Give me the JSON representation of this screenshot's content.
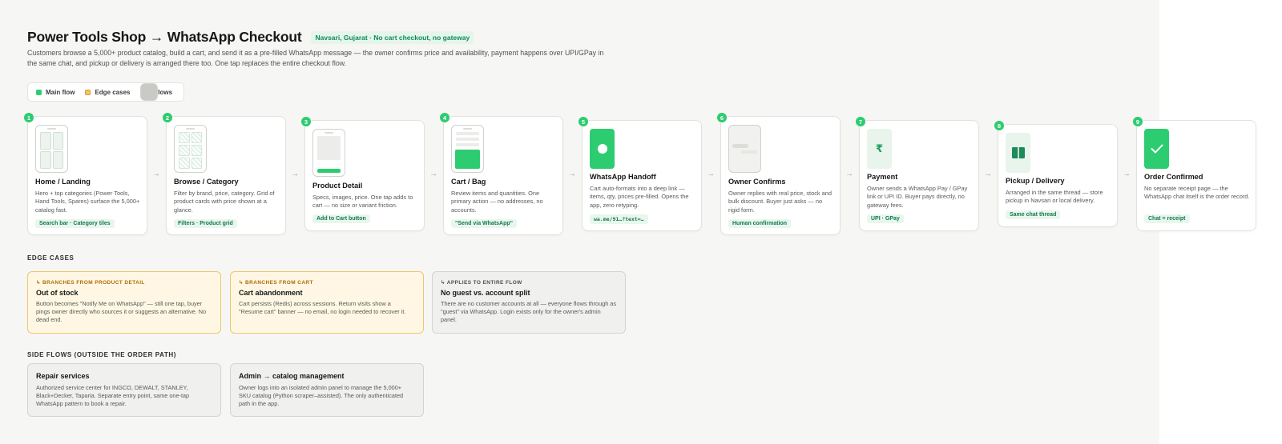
{
  "header": {
    "title": "Power Tools Shop → WhatsApp Checkout",
    "badge": "Navsari, Gujarat · No cart checkout, no gateway",
    "description": "Customers browse a 5,000+ product catalog, build a cart, and send it as a pre-filled WhatsApp message — the owner confirms price and availability, payment happens over UPI/GPay in the same chat, and pickup or delivery is arranged there too. One tap replaces the entire checkout flow."
  },
  "legend": [
    {
      "label": "Main flow",
      "color": "#2ecc71"
    },
    {
      "label": "Edge cases",
      "color": "#f5c36a"
    },
    {
      "label": "Side flows",
      "color": "#c9c9c6"
    }
  ],
  "steps": [
    {
      "num": "1",
      "title": "Home / Landing",
      "desc": "Hero + top categories (Power Tools, Hand Tools, Spares) surface the 5,000+ catalog fast.",
      "tag": "Search bar · Category tiles",
      "icon": "phone-grid-icon"
    },
    {
      "num": "2",
      "title": "Browse / Category",
      "desc": "Filter by brand, price, category. Grid of product cards with price shown at a glance.",
      "tag": "Filters · Product grid",
      "icon": "phone-product-grid-icon"
    },
    {
      "num": "3",
      "title": "Product Detail",
      "desc": "Specs, images, price. One tap adds to cart — no size or variant friction.",
      "tag": "Add to Cart button",
      "icon": "phone-product-detail-icon"
    },
    {
      "num": "4",
      "title": "Cart / Bag",
      "desc": "Review items and quantities. One primary action — no addresses, no accounts.",
      "tag": "\"Send via WhatsApp\"",
      "icon": "phone-cart-icon"
    },
    {
      "num": "5",
      "title": "WhatsApp Handoff",
      "desc": "Cart auto-formats into a deep link — items, qty, prices pre-filled. Opens the app, zero retyping.",
      "tag": "wa.me/91…?text=…",
      "icon": "whatsapp-bubble-icon"
    },
    {
      "num": "6",
      "title": "Owner Confirms",
      "desc": "Owner replies with real price, stock and bulk discount. Buyer just asks — no rigid form.",
      "tag": "Human confirmation",
      "icon": "phone-chat-icon"
    },
    {
      "num": "7",
      "title": "Payment",
      "desc": "Owner sends a WhatsApp Pay / GPay link or UPI ID. Buyer pays directly, no gateway fees.",
      "tag": "UPI · GPay",
      "icon": "rupee-icon"
    },
    {
      "num": "8",
      "title": "Pickup / Delivery",
      "desc": "Arranged in the same thread — store pickup in Navsari or local delivery.",
      "tag": "Same chat thread",
      "icon": "package-icon"
    },
    {
      "num": "9",
      "title": "Order Confirmed",
      "desc": "No separate receipt page — the WhatsApp chat itself is the order record.",
      "tag": "Chat = receipt",
      "icon": "checkmark-icon"
    }
  ],
  "edge_cases": {
    "title": "EDGE CASES",
    "items": [
      {
        "kicker": "↳ BRANCHES FROM PRODUCT DETAIL",
        "title": "Out of stock",
        "desc": "Button becomes \"Notify Me on WhatsApp\" — still one tap, buyer pings owner directly who sources it or suggests an alternative. No dead end."
      },
      {
        "kicker": "↳ BRANCHES FROM CART",
        "title": "Cart abandonment",
        "desc": "Cart persists (Redis) across sessions. Return visits show a \"Resume cart\" banner — no email, no login needed to recover it."
      },
      {
        "kicker": "↳ APPLIES TO ENTIRE FLOW",
        "title": "No guest vs. account split",
        "desc": "There are no customer accounts at all — everyone flows through as \"guest\" via WhatsApp. Login exists only for the owner's admin panel."
      }
    ]
  },
  "side_flows": {
    "title": "SIDE FLOWS (OUTSIDE THE ORDER PATH)",
    "items": [
      {
        "title": "Repair services",
        "desc": "Authorized service center for INGCO, DEWALT, STANLEY, Black+Decker, Taparia. Separate entry point, same one-tap WhatsApp pattern to book a repair."
      },
      {
        "title": "Admin → catalog management",
        "desc": "Owner logs into an isolated admin panel to manage the 5,000+ SKU catalog (Python scraper–assisted). The only authenticated path in the app."
      }
    ]
  },
  "colors": {
    "accent": "#2ecc71",
    "edge": "#f5c36a",
    "side": "#c9c9c6"
  }
}
